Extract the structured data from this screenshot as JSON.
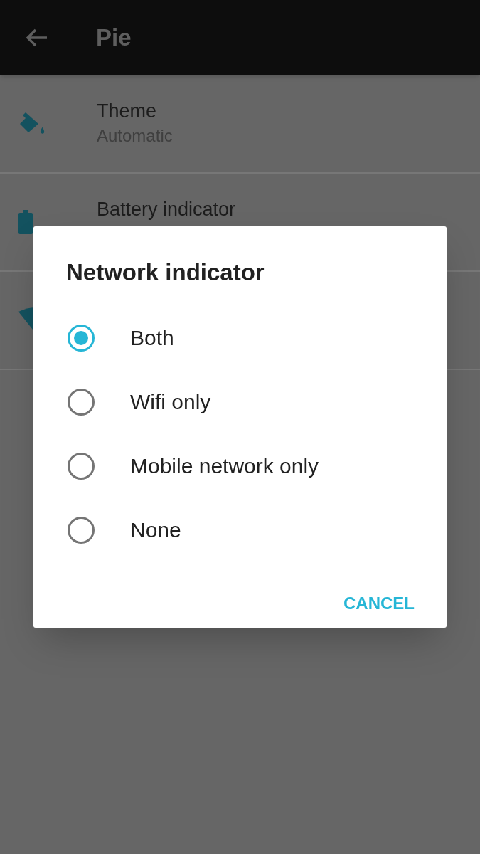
{
  "app_bar": {
    "title": "Pie"
  },
  "settings": [
    {
      "title": "Theme",
      "subtitle": "Automatic"
    },
    {
      "title": "Battery indicator"
    }
  ],
  "dialog": {
    "title": "Network indicator",
    "options": [
      {
        "label": "Both",
        "selected": true
      },
      {
        "label": "Wifi only",
        "selected": false
      },
      {
        "label": "Mobile network only",
        "selected": false
      },
      {
        "label": "None",
        "selected": false
      }
    ],
    "buttons": [
      "CANCEL"
    ]
  }
}
